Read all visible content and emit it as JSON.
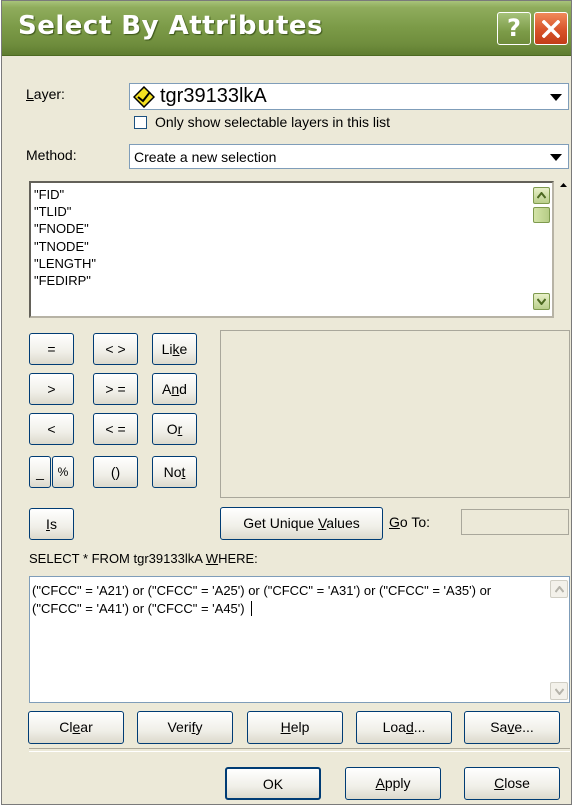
{
  "window": {
    "title": "Select By Attributes"
  },
  "titlebar_buttons": {
    "help": "?",
    "close_icon": "close-x-icon"
  },
  "layer": {
    "label": "Layer:",
    "value": "tgr39133lkA",
    "icon": "layer-diamond-icon"
  },
  "selectable_only": {
    "label": "Only show selectable layers in this list",
    "checked": false
  },
  "method": {
    "label": "Method:",
    "value": "Create a new selection"
  },
  "fields": [
    "\"FID\"",
    "\"TLID\"",
    "\"FNODE\"",
    "\"TNODE\"",
    "\"LENGTH\"",
    "\"FEDIRP\""
  ],
  "operators": {
    "eq": "=",
    "ne": "< >",
    "like": "Like",
    "gt": ">",
    "ge": "> =",
    "and": "And",
    "lt": "<",
    "le": "< =",
    "or": "Or",
    "underscore": "_",
    "percent": "%",
    "parens": "()",
    "not": "Not",
    "is": "Is"
  },
  "get_unique_values": "Get Unique Values",
  "goto": {
    "label": "Go To:",
    "value": ""
  },
  "query": {
    "label": "SELECT * FROM tgr39133lkA WHERE:",
    "text": "(\"CFCC\" = 'A21') or (\"CFCC\" = 'A25') or (\"CFCC\" = 'A31') or (\"CFCC\" = 'A35') or (\"CFCC\" = 'A41') or (\"CFCC\" = 'A45')"
  },
  "action_buttons": {
    "clear": "Clear",
    "verify": "Verify",
    "help": "Help",
    "load": "Load...",
    "save": "Save..."
  },
  "footer_buttons": {
    "ok": "OK",
    "apply": "Apply",
    "close": "Close"
  },
  "colors": {
    "titlebar": "#7b9a47",
    "close_button": "#d8532a",
    "dialog_bg": "#ece9d8"
  }
}
